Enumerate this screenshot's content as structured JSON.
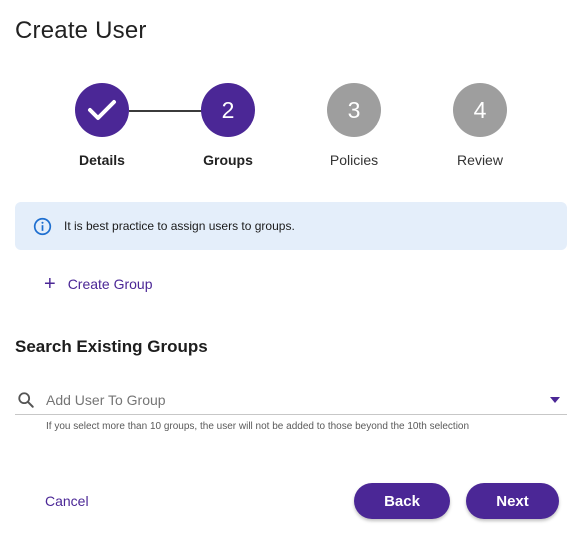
{
  "page": {
    "title": "Create User"
  },
  "stepper": {
    "steps": [
      {
        "number": "",
        "label": "Details",
        "state": "done"
      },
      {
        "number": "2",
        "label": "Groups",
        "state": "active"
      },
      {
        "number": "3",
        "label": "Policies",
        "state": "pending"
      },
      {
        "number": "4",
        "label": "Review",
        "state": "pending"
      }
    ]
  },
  "info": {
    "text": "It is best practice to assign users to groups.",
    "icon": "info-icon"
  },
  "create_group": {
    "label": "Create Group",
    "icon": "plus-icon"
  },
  "search_section": {
    "title": "Search Existing Groups",
    "placeholder": "Add User To Group",
    "helper": "If you select more than 10 groups, the user will not be added to those beyond the 10th selection"
  },
  "actions": {
    "cancel": "Cancel",
    "back": "Back",
    "next": "Next"
  },
  "colors": {
    "accent": "#4b2796",
    "pending": "#9e9e9e",
    "info_bg": "#e4eefa",
    "info_icon": "#1e6fd0"
  }
}
